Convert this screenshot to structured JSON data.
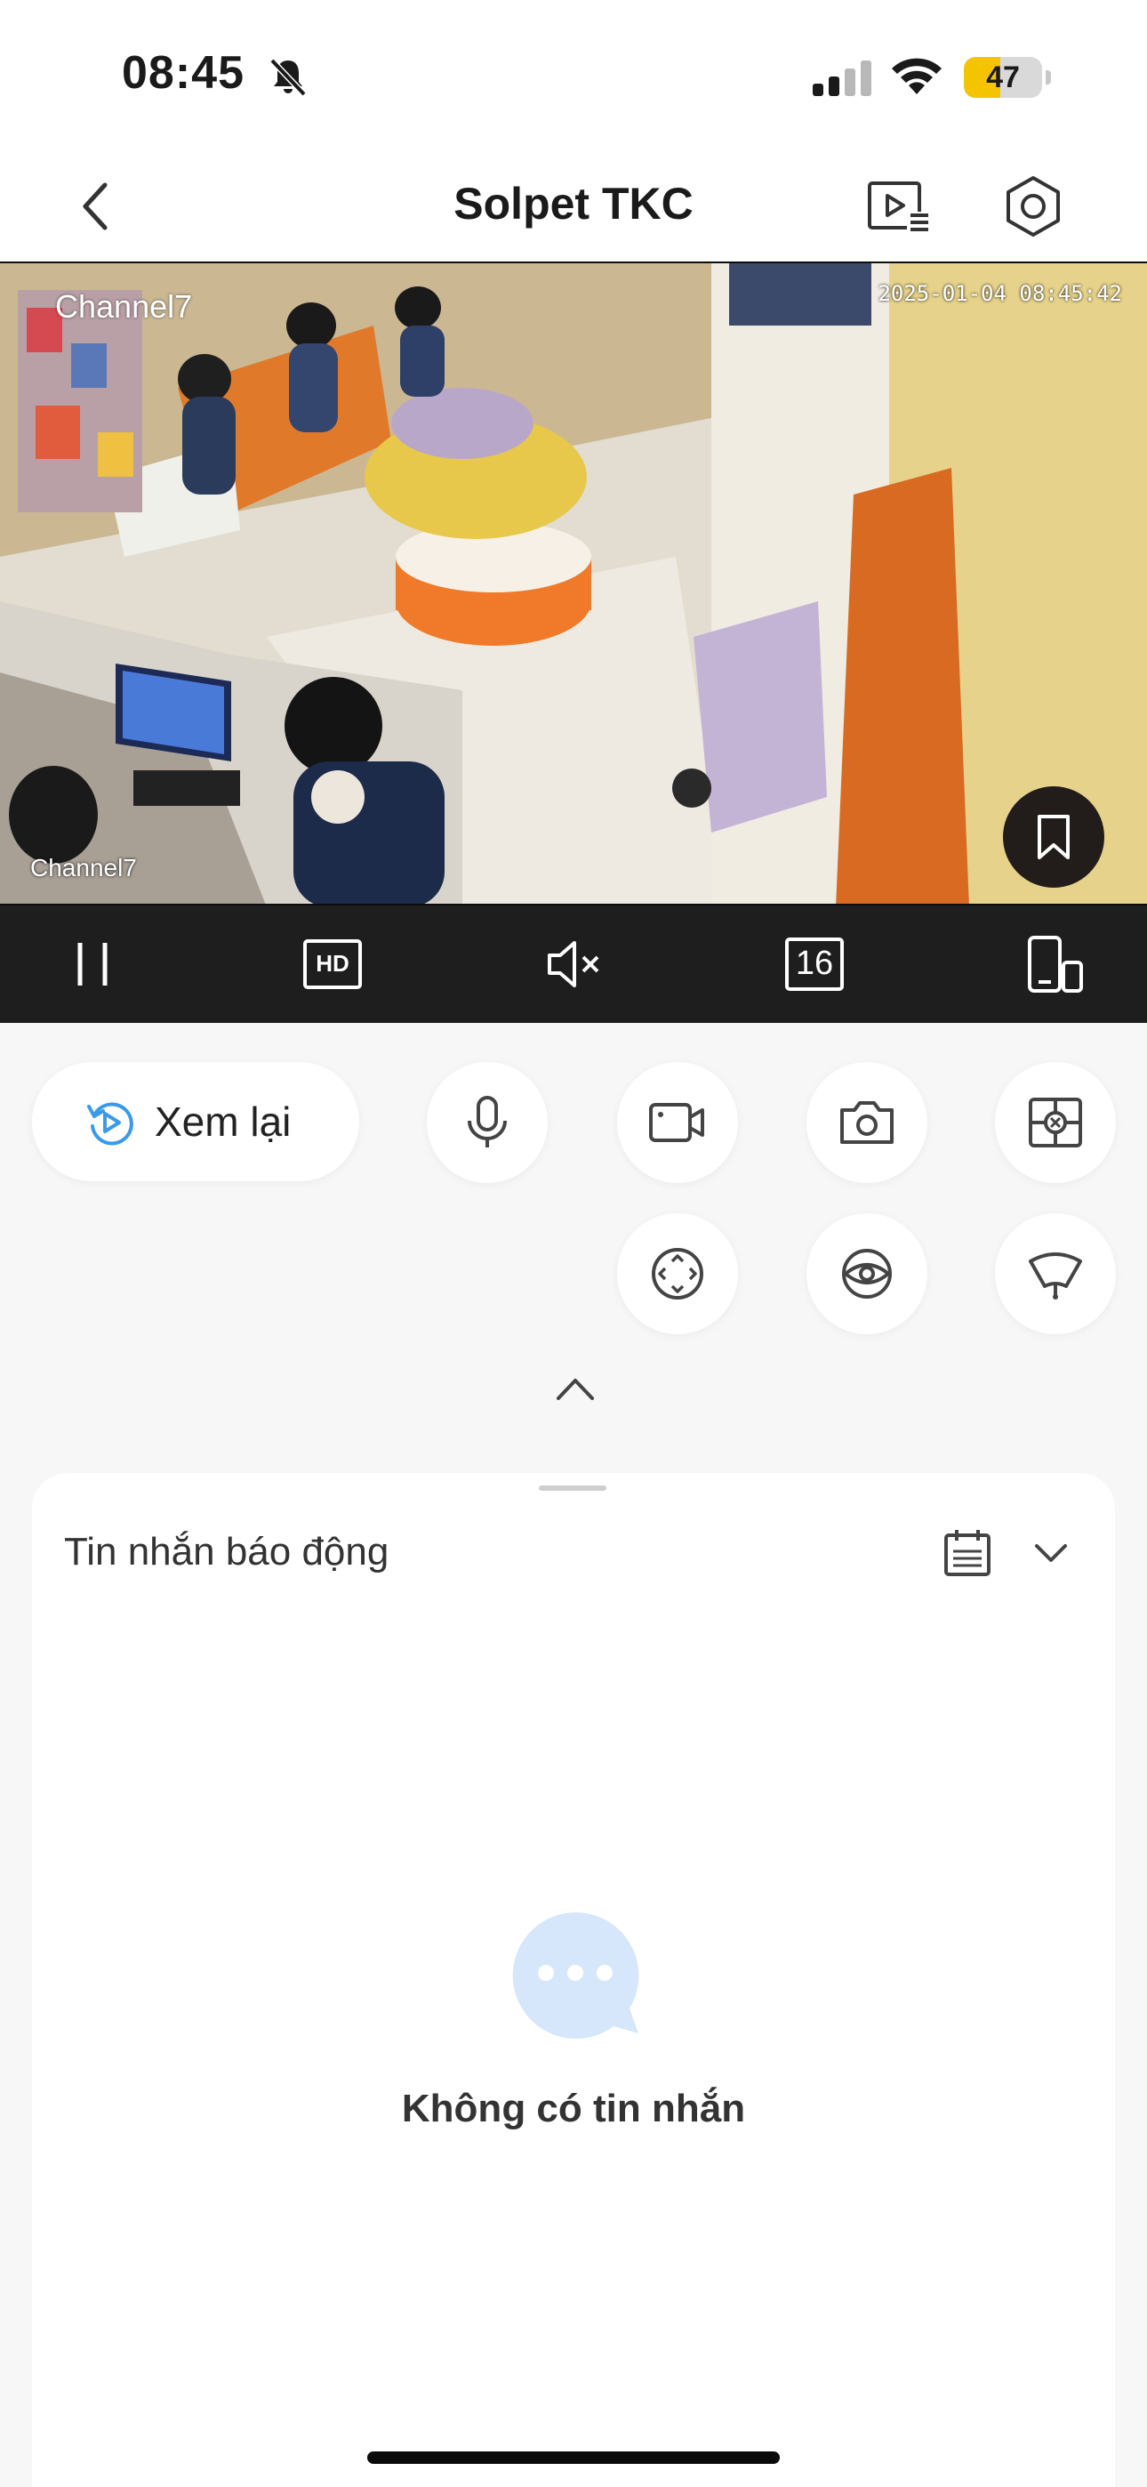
{
  "status_bar": {
    "time": "08:45",
    "battery": "47",
    "battery_level": 0.47
  },
  "nav": {
    "title": "Solpet TKC"
  },
  "video": {
    "channel_label_top": "Channel7",
    "timestamp": "2025-01-04 08:45:42",
    "channel_label_bottom": "Channel7"
  },
  "controls": {
    "quality": "HD",
    "split_count": "16"
  },
  "actions": {
    "replay_label": "Xem lại"
  },
  "alarm": {
    "title": "Tin nhắn báo động",
    "empty_text": "Không có tin nhắn"
  },
  "colors": {
    "accent": "#3a9ae8",
    "control_bar": "#1e1e1e",
    "battery_fill": "#f5c400"
  }
}
